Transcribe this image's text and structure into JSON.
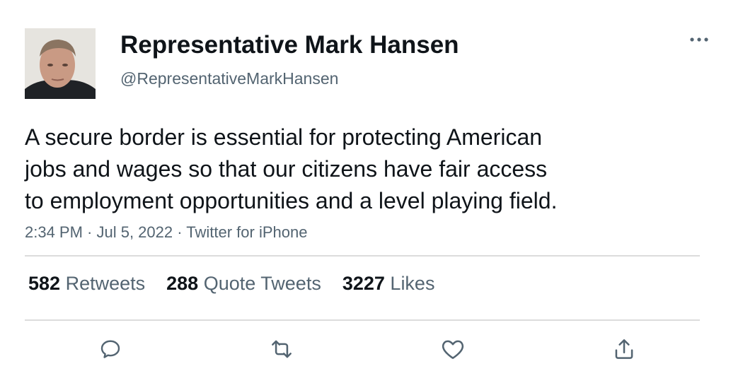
{
  "author": {
    "display_name": "Representative Mark Hansen",
    "handle": "@RepresentativeMarkHansen"
  },
  "tweet": {
    "lines": [
      "A secure border is essential for protecting American",
      "jobs and wages so that our citizens have fair access",
      "to employment opportunities and a level playing field."
    ],
    "meta": "2:34 PM · Jul 5, 2022 · Twitter for iPhone"
  },
  "stats": [
    {
      "count": "582",
      "label": "Retweets"
    },
    {
      "count": "288",
      "label": "Quote Tweets"
    },
    {
      "count": "3227",
      "label": "Likes"
    }
  ],
  "icons": {
    "more": "more-horizontal-icon",
    "reply": "reply-icon",
    "retweet": "retweet-icon",
    "like": "heart-icon",
    "share": "share-icon"
  },
  "colors": {
    "text_primary": "#0f1419",
    "text_secondary": "#536471",
    "divider": "#dcdcdc"
  }
}
